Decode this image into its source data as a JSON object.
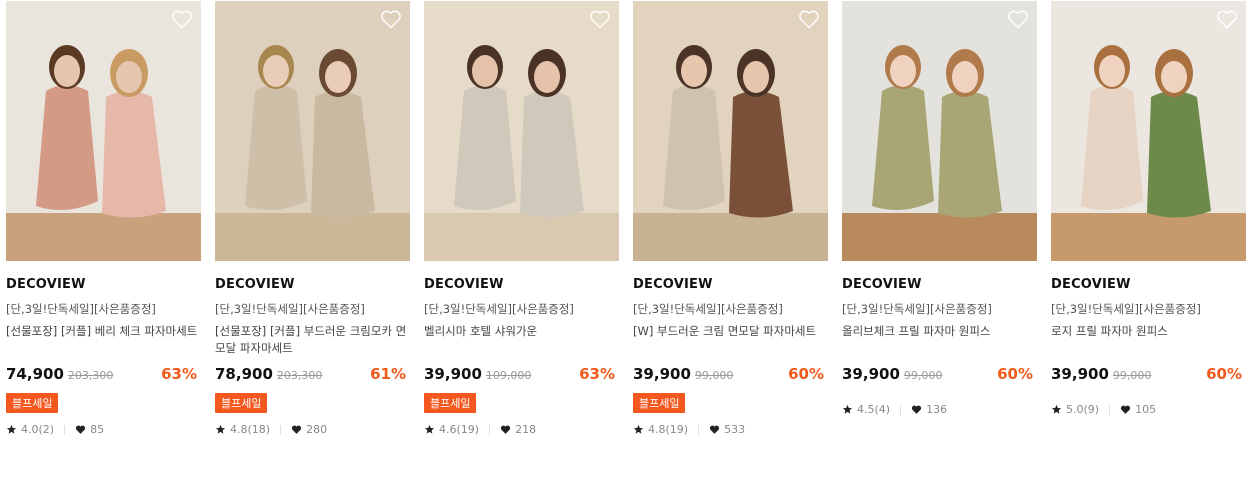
{
  "products": [
    {
      "brand": "DECOVIEW",
      "promo": "[단,3일!단독세일][사은품증정]",
      "name": "[선물포장] [커플] 베리 체크 파자마세트",
      "price": "74,900",
      "original_price": "203,300",
      "discount": "63%",
      "badge": "블프세일",
      "rating": "4.0(2)",
      "likes": "85",
      "scene": {
        "bg": "#e9e4dc",
        "floor": "#c9a27d",
        "fig1": "#d49a86",
        "fig2": "#e6b8aa",
        "skin": "#e7c6b0",
        "hair1": "#5a3a22",
        "hair2": "#c99a62"
      }
    },
    {
      "brand": "DECOVIEW",
      "promo": "[단,3일!단독세일][사은품증정]",
      "name": "[선물포장] [커플] 부드러운 크림모카 면모달 파자마세트",
      "price": "78,900",
      "original_price": "203,300",
      "discount": "61%",
      "badge": "블프세일",
      "rating": "4.8(18)",
      "likes": "280",
      "scene": {
        "bg": "#ddd0bc",
        "floor": "#cbb899",
        "fig1": "#cdbfa8",
        "fig2": "#c9b9a0",
        "skin": "#e9cdb8",
        "hair1": "#a8864f",
        "hair2": "#6b4a33"
      }
    },
    {
      "brand": "DECOVIEW",
      "promo": "[단,3일!단독세일][사은품증정]",
      "name": "벨리시마 호텔 샤워가운",
      "price": "39,900",
      "original_price": "109,000",
      "discount": "63%",
      "badge": "블프세일",
      "rating": "4.6(19)",
      "likes": "218",
      "scene": {
        "bg": "#e6dac8",
        "floor": "#d9c9b1",
        "fig1": "#cfc8bb",
        "fig2": "#cfc8bb",
        "skin": "#e5c3ab",
        "hair1": "#4a3326",
        "hair2": "#4a3326"
      }
    },
    {
      "brand": "DECOVIEW",
      "promo": "[단,3일!단독세일][사은품증정]",
      "name": "[W] 부드러운 크림 면모달 파자마세트",
      "price": "39,900",
      "original_price": "99,000",
      "discount": "60%",
      "badge": "블프세일",
      "rating": "4.8(19)",
      "likes": "533",
      "scene": {
        "bg": "#e1d3bd",
        "floor": "#c7b394",
        "fig1": "#cfc3ae",
        "fig2": "#7a5138",
        "skin": "#e6c6ad",
        "hair1": "#4b3427",
        "hair2": "#4b3427"
      }
    },
    {
      "brand": "DECOVIEW",
      "promo": "[단,3일!단독세일][사은품증정]",
      "name": "올리브체크 프릴 파자마 원피스",
      "price": "39,900",
      "original_price": "99,000",
      "discount": "60%",
      "badge": "",
      "rating": "4.5(4)",
      "likes": "136",
      "scene": {
        "bg": "#e4e2dc",
        "floor": "#b88a5c",
        "fig1": "#a9a675",
        "fig2": "#a9a675",
        "skin": "#efd3c0",
        "hair1": "#b07a4a",
        "hair2": "#b07a4a"
      }
    },
    {
      "brand": "DECOVIEW",
      "promo": "[단,3일!단독세일][사은품증정]",
      "name": "로지 프릴 파자마 원피스",
      "price": "39,900",
      "original_price": "99,000",
      "discount": "60%",
      "badge": "",
      "rating": "5.0(9)",
      "likes": "105",
      "scene": {
        "bg": "#ebe7e0",
        "floor": "#c79a6e",
        "fig1": "#e6d3c3",
        "fig2": "#6d8a4a",
        "skin": "#efd3c0",
        "hair1": "#a9713f",
        "hair2": "#a9713f"
      }
    }
  ],
  "colors": {
    "accent": "#f4581f",
    "discount": "#f05a1a"
  },
  "icons": {
    "wish": "heart-outline-icon",
    "rating": "star-icon",
    "likes": "heart-filled-icon"
  }
}
